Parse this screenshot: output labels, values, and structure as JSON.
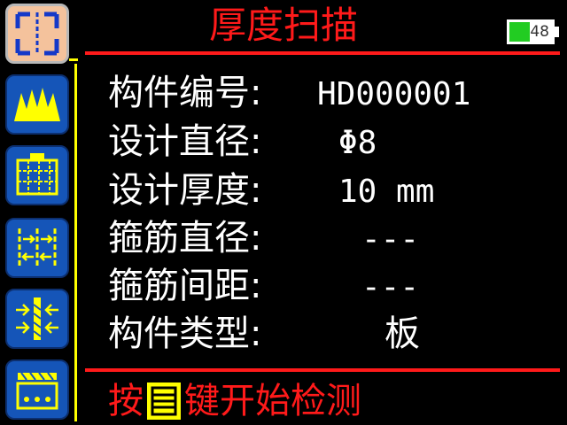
{
  "header": {
    "title": "厚度扫描",
    "battery_level": "48",
    "battery_fraction": 0.48
  },
  "fields": [
    {
      "label": "构件编号:",
      "value": "HD000001"
    },
    {
      "label": "设计直径:",
      "value": "Φ8"
    },
    {
      "label": "设计厚度:",
      "value": "10 mm"
    },
    {
      "label": "箍筋直径:",
      "value": "---"
    },
    {
      "label": "箍筋间距:",
      "value": "---"
    },
    {
      "label": "构件类型:",
      "value": "板"
    }
  ],
  "footer": {
    "prefix": "按",
    "suffix": "键开始检测",
    "key_icon": "menu-key-icon"
  },
  "sidebar": {
    "items": [
      {
        "icon": "thickness-scan-icon",
        "active": true
      },
      {
        "icon": "wave-scan-icon",
        "active": false
      },
      {
        "icon": "grid-scan-icon",
        "active": false
      },
      {
        "icon": "rebar-spacing-icon",
        "active": false
      },
      {
        "icon": "rebar-cover-icon",
        "active": false
      },
      {
        "icon": "slab-scan-icon",
        "active": false
      }
    ]
  },
  "colors": {
    "accent": "#ff1a1a",
    "highlight": "#ffff00",
    "tile": "#1555b8",
    "active_tile": "#f4c29c",
    "battery": "#22cc22"
  }
}
